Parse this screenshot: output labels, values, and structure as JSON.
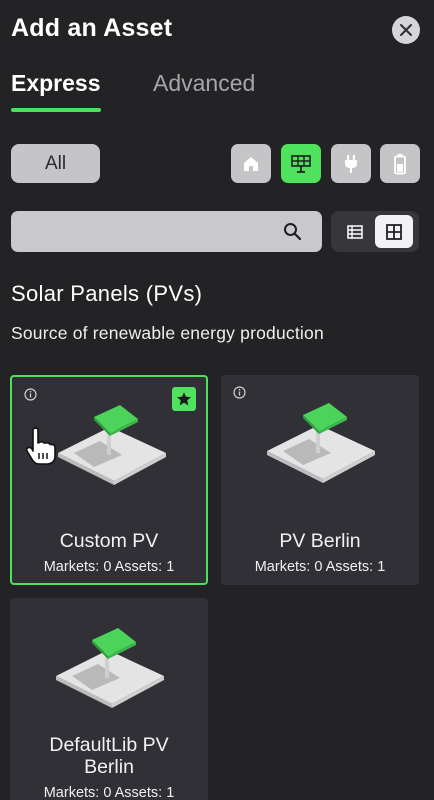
{
  "header": {
    "title": "Add an Asset"
  },
  "tabs": [
    {
      "label": "Express",
      "active": true
    },
    {
      "label": "Advanced",
      "active": false
    }
  ],
  "filters": {
    "all_label": "All",
    "icons": [
      {
        "name": "house-icon",
        "active": false
      },
      {
        "name": "solar-panel-icon",
        "active": true
      },
      {
        "name": "plug-icon",
        "active": false
      },
      {
        "name": "battery-icon",
        "active": false
      }
    ]
  },
  "search": {
    "placeholder": "",
    "value": ""
  },
  "view": {
    "mode": "grid"
  },
  "section": {
    "title": "Solar Panels (PVs)",
    "description": "Source of renewable energy production"
  },
  "cards": [
    {
      "name": "Custom PV",
      "stats": "Markets: 0 Assets: 1",
      "selected": true,
      "favorite": true
    },
    {
      "name": "PV Berlin",
      "stats": "Markets: 0 Assets: 1",
      "selected": false,
      "favorite": false
    },
    {
      "name": "DefaultLib PV Berlin",
      "name_line1": "DefaultLib PV",
      "name_line2": "Berlin",
      "stats": "Markets: 0 Assets: 1",
      "selected": false,
      "favorite": false
    }
  ],
  "colors": {
    "accent": "#4ee05a",
    "background": "#232325",
    "card": "#303036"
  }
}
